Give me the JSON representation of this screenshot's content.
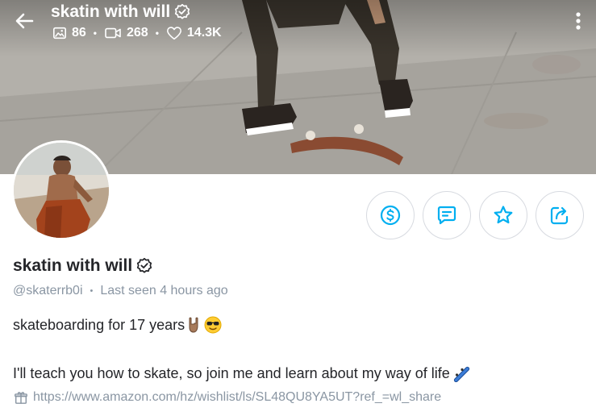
{
  "header": {
    "title": "skatin with will",
    "stats": {
      "photos": "86",
      "videos": "268",
      "likes": "14.3K"
    }
  },
  "profile": {
    "name": "skatin with will",
    "handle": "@skaterrb0i",
    "last_seen": "Last seen 4 hours ago"
  },
  "bio": {
    "line1": "skateboarding for 17 years",
    "line2": "I'll teach you how to skate, so join me and learn about my way of life",
    "link": "https://www.amazon.com/hz/wishlist/ls/SL48QU8YA5UT?ref_=wl_share"
  },
  "icons": {
    "back": "back-arrow-icon",
    "verified": "verified-badge-icon",
    "photos": "image-icon",
    "videos": "video-icon",
    "likes": "heart-icon",
    "more": "more-vertical-icon",
    "tip": "dollar-icon",
    "message": "message-icon",
    "favorite": "star-icon",
    "share": "share-icon",
    "link": "gift-icon"
  },
  "colors": {
    "accent": "#00aff0",
    "text": "#242529",
    "muted": "#8a96a3",
    "border": "#d7dae0"
  }
}
